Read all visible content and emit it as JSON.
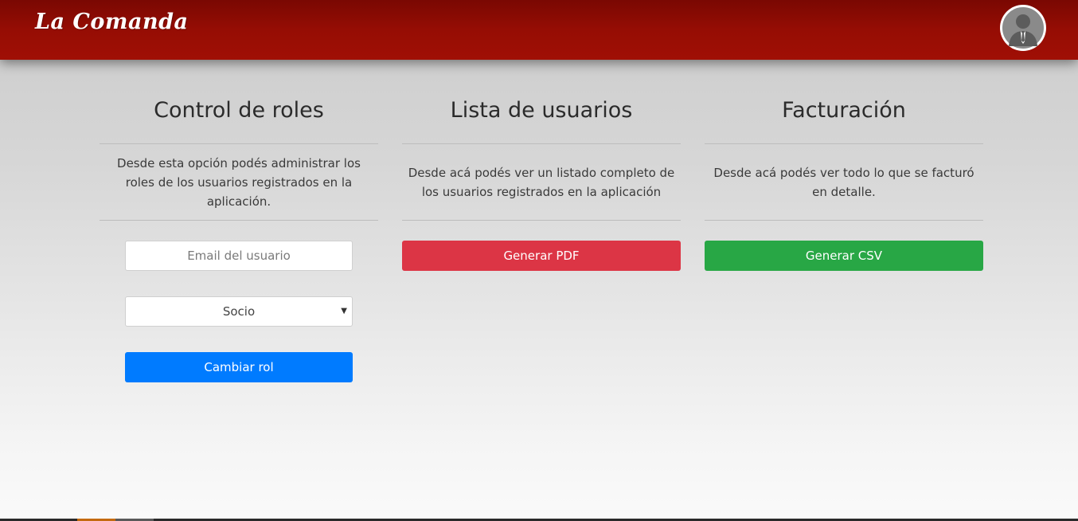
{
  "header": {
    "brand": "La Comanda",
    "avatar_icon": "user-avatar-icon"
  },
  "columns": [
    {
      "title": "Control de roles",
      "description": "Desde esta opción podés administrar los roles de los usuarios registrados en la aplicación.",
      "email_placeholder": "Email del usuario",
      "role_select": {
        "selected": "Socio",
        "caret_icon": "caret-down-icon"
      },
      "button_label": "Cambiar rol"
    },
    {
      "title": "Lista de usuarios",
      "description": "Desde acá podés ver un listado completo de los usuarios registrados en la aplicación",
      "button_label": "Generar PDF"
    },
    {
      "title": "Facturación",
      "description": "Desde acá podés ver todo lo que se facturó en detalle.",
      "button_label": "Generar CSV"
    }
  ],
  "colors": {
    "navbar": "#960d04",
    "primary": "#007bff",
    "danger": "#dc3545",
    "success": "#28a745"
  }
}
